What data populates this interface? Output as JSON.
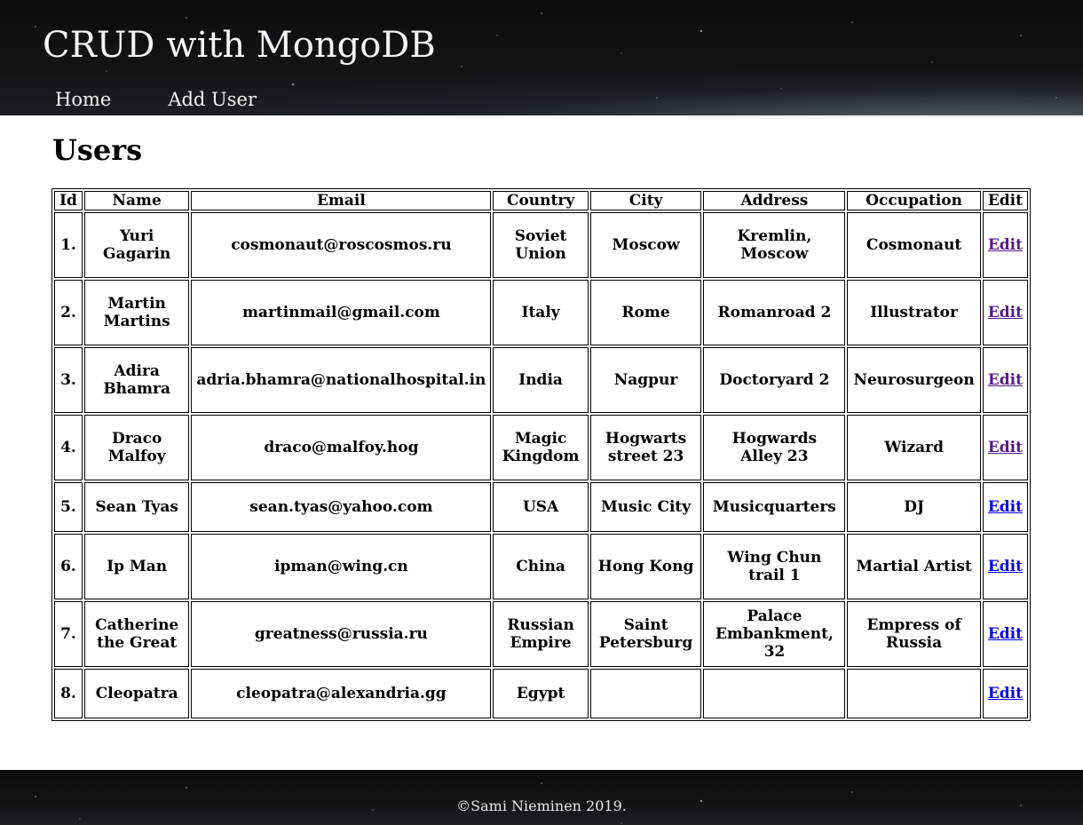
{
  "header": {
    "title": "CRUD with MongoDB",
    "nav": [
      {
        "label": "Home"
      },
      {
        "label": "Add User"
      }
    ]
  },
  "main": {
    "heading": "Users",
    "table": {
      "columns": [
        "Id",
        "Name",
        "Email",
        "Country",
        "City",
        "Address",
        "Occupation",
        "Edit"
      ],
      "rows": [
        {
          "id": "1.",
          "name": "Yuri Gagarin",
          "email": "cosmonaut@roscosmos.ru",
          "country": "Soviet Union",
          "city": "Moscow",
          "address": "Kremlin, Moscow",
          "occupation": "Cosmonaut",
          "edit": "Edit",
          "edit_visited": true
        },
        {
          "id": "2.",
          "name": "Martin Martins",
          "email": "martinmail@gmail.com",
          "country": "Italy",
          "city": "Rome",
          "address": "Romanroad 2",
          "occupation": "Illustrator",
          "edit": "Edit",
          "edit_visited": true
        },
        {
          "id": "3.",
          "name": "Adira Bhamra",
          "email": "adria.bhamra@nationalhospital.in",
          "country": "India",
          "city": "Nagpur",
          "address": "Doctoryard 2",
          "occupation": "Neurosurgeon",
          "edit": "Edit",
          "edit_visited": true
        },
        {
          "id": "4.",
          "name": "Draco Malfoy",
          "email": "draco@malfoy.hog",
          "country": "Magic Kingdom",
          "city": "Hogwarts street 23",
          "address": "Hogwards Alley 23",
          "occupation": "Wizard",
          "edit": "Edit",
          "edit_visited": true
        },
        {
          "id": "5.",
          "name": "Sean Tyas",
          "email": "sean.tyas@yahoo.com",
          "country": "USA",
          "city": "Music City",
          "address": "Musicquarters",
          "occupation": "DJ",
          "edit": "Edit",
          "edit_visited": false
        },
        {
          "id": "6.",
          "name": "Ip Man",
          "email": "ipman@wing.cn",
          "country": "China",
          "city": "Hong Kong",
          "address": "Wing Chun trail 1",
          "occupation": "Martial Artist",
          "edit": "Edit",
          "edit_visited": false
        },
        {
          "id": "7.",
          "name": "Catherine the Great",
          "email": "greatness@russia.ru",
          "country": "Russian Empire",
          "city": "Saint Petersburg",
          "address": "Palace Embankment, 32",
          "occupation": "Empress of Russia",
          "edit": "Edit",
          "edit_visited": false
        },
        {
          "id": "8.",
          "name": "Cleopatra",
          "email": "cleopatra@alexandria.gg",
          "country": "Egypt",
          "city": "",
          "address": "",
          "occupation": "",
          "edit": "Edit",
          "edit_visited": false
        }
      ]
    }
  },
  "footer": {
    "copyright": "©Sami Nieminen 2019."
  },
  "colors": {
    "link": "#0000ee",
    "link_visited": "#551a8b",
    "header_text": "#f4f4f4"
  }
}
